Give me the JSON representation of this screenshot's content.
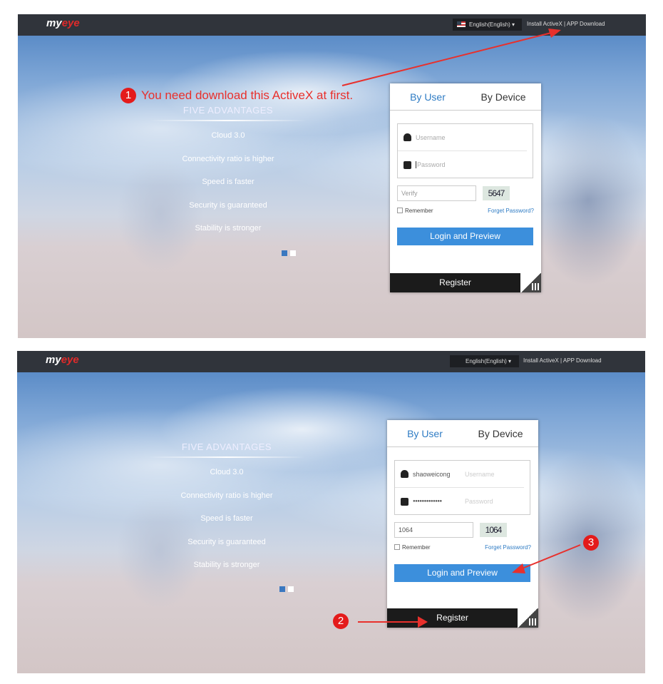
{
  "header": {
    "logo": "myeye",
    "language": "English(English)",
    "install_activex": "Install ActiveX",
    "separator": "|",
    "app_download": "APP Download"
  },
  "advantages": {
    "title": "FIVE ADVANTAGES",
    "items": [
      "Cloud 3.0",
      "Connectivity ratio is higher",
      "Speed is faster",
      "Security is guaranteed",
      "Stability is stronger"
    ]
  },
  "login": {
    "tabs": [
      "By User",
      "By Device"
    ],
    "username_placeholder": "Username",
    "password_placeholder": "Password",
    "verify_placeholder": "Verify",
    "remember": "Remember",
    "forget": "Forget Password?",
    "login_button": "Login and Preview",
    "register": "Register"
  },
  "screen1": {
    "captcha": "5647",
    "annotation_number": "1",
    "annotation_text": "You need download this ActiveX at first."
  },
  "screen2": {
    "username_value": "shaoweicong",
    "password_value": "●●●●●●●●●●●●●",
    "verify_value": "1064",
    "captcha": "1064",
    "annotation_2": "2",
    "annotation_3": "3"
  },
  "colors": {
    "accent": "#3c8fdc",
    "annotation": "#e41b1b",
    "header": "#30343b"
  }
}
